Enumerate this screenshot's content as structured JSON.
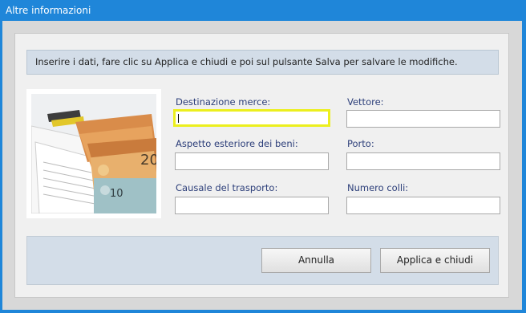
{
  "window": {
    "title": "Altre informazioni"
  },
  "info": {
    "text": "Inserire i dati, fare clic su Applica e chiudi e poi sul pulsante Salva per salvare le modifiche."
  },
  "form": {
    "destinazione": {
      "label": "Destinazione merce:",
      "value": ""
    },
    "vettore": {
      "label": "Vettore:",
      "value": ""
    },
    "aspetto": {
      "label": "Aspetto esteriore dei beni:",
      "value": ""
    },
    "porto": {
      "label": "Porto:",
      "value": ""
    },
    "causale": {
      "label": "Causale del trasporto:",
      "value": ""
    },
    "colli": {
      "label": "Numero colli:",
      "value": ""
    }
  },
  "buttons": {
    "cancel": "Annulla",
    "apply": "Applica e chiudi"
  },
  "colors": {
    "titlebar": "#1f86d9",
    "focus_border": "#ecef1e",
    "label_text": "#2d3f7a",
    "panel": "#d3dde8"
  }
}
